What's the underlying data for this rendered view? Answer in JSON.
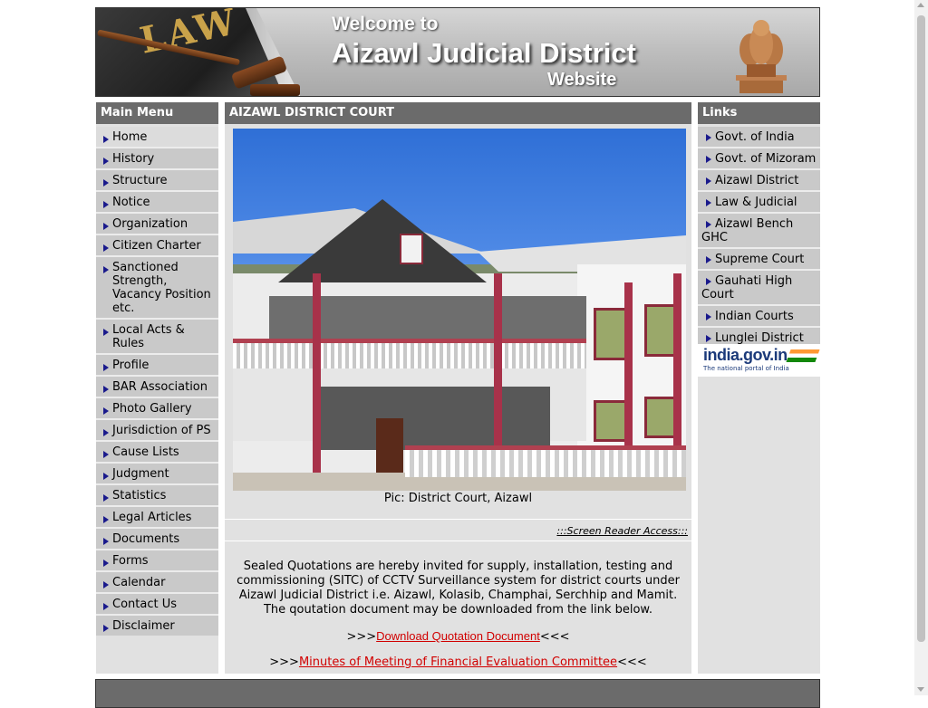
{
  "banner": {
    "line1": "Welcome to",
    "line2": "Aizawl Judicial District",
    "line3": "Website",
    "book_text": "LAW"
  },
  "main_menu": {
    "title": "Main Menu",
    "items": [
      "Home",
      "History",
      "Structure",
      "Notice",
      "Organization",
      "Citizen Charter",
      "Sanctioned Strength, Vacancy Position etc.",
      "Local Acts & Rules",
      "Profile",
      "BAR Association",
      "Photo Gallery",
      "Jurisdiction of PS",
      "Cause Lists",
      "Judgment",
      "Statistics",
      "Legal Articles",
      "Documents",
      "Forms",
      "Calendar",
      "Contact Us",
      "Disclaimer"
    ]
  },
  "center": {
    "title": "AIZAWL DISTRICT COURT",
    "photo_caption": "Pic: District Court, Aizawl",
    "screen_reader": ":::Screen Reader Access:::",
    "notice": "Sealed Quotations are hereby invited for supply, installation, testing and commissioning (SITC) of CCTV Surveillance system for district courts under Aizawl Judicial District i.e. Aizawl, Kolasib, Champhai, Serchhip and Mamit. The qoutation document may be downloaded from the link below.",
    "link1_prefix": ">>>",
    "link1": "Download Quotation Document",
    "link1_suffix": "<<<",
    "link2_prefix": ">>>",
    "link2": "Minutes of Meeting of Financial Evaluation Committee",
    "link2_suffix": "<<<"
  },
  "links": {
    "title": "Links",
    "items": [
      "Govt. of India",
      "Govt. of Mizoram",
      "Aizawl District",
      "Law & Judicial",
      "Aizawl Bench GHC",
      "Supreme Court",
      "Gauhati High Court",
      "Indian Courts",
      "Lunglei District Court"
    ],
    "portal_name": "india.gov.in",
    "portal_tagline": "The national portal of India"
  },
  "colors": {
    "menu_header": "#6b6b6b",
    "menu_item_bg": "#c9c9c9",
    "bullet": "#1a1a8c",
    "link_red": "#d10000"
  }
}
